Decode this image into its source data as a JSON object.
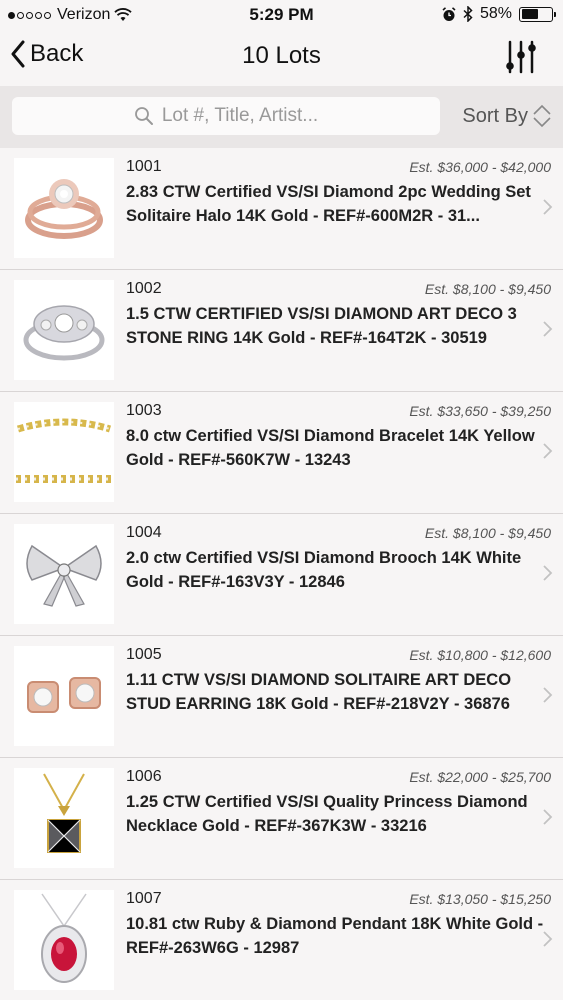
{
  "status_bar": {
    "carrier": "Verizon",
    "time": "5:29 PM",
    "battery_text": "58%",
    "battery_level": 0.58
  },
  "nav": {
    "back_label": "Back",
    "title": "10 Lots"
  },
  "search": {
    "placeholder": "Lot #, Title, Artist...",
    "sort_label": "Sort By"
  },
  "lots": [
    {
      "number": "1001",
      "estimate": "Est. $36,000 - $42,000",
      "title": "2.83 CTW Certified VS/SI Diamond 2pc Wedding Set Solitaire Halo 14K Gold - REF#-600M2R - 31...",
      "image": "rose-gold-halo-ring-set"
    },
    {
      "number": "1002",
      "estimate": "Est. $8,100 - $9,450",
      "title": "1.5 CTW CERTIFIED VS/SI DIAMOND ART DECO 3 STONE RING 14K Gold - REF#-164T2K - 30519",
      "image": "white-gold-art-deco-ring"
    },
    {
      "number": "1003",
      "estimate": "Est. $33,650 - $39,250",
      "title": "8.0 ctw Certified VS/SI Diamond Bracelet 14K Yellow Gold - REF#-560K7W - 13243",
      "image": "yellow-gold-diamond-bracelet"
    },
    {
      "number": "1004",
      "estimate": "Est. $8,100 - $9,450",
      "title": "2.0 ctw Certified VS/SI Diamond Brooch 14K White Gold - REF#-163V3Y - 12846",
      "image": "white-gold-bow-brooch"
    },
    {
      "number": "1005",
      "estimate": "Est. $10,800 - $12,600",
      "title": "1.11 CTW VS/SI DIAMOND SOLITAIRE ART DECO STUD EARRING 18K Gold - REF#-218V2Y - 36876",
      "image": "rose-gold-stud-earrings"
    },
    {
      "number": "1006",
      "estimate": "Est. $22,000 - $25,700",
      "title": "1.25 CTW Certified VS/SI Quality Princess Diamond Necklace Gold - REF#-367K3W - 33216",
      "image": "princess-diamond-necklace"
    },
    {
      "number": "1007",
      "estimate": "Est. $13,050 - $15,250",
      "title": "10.81 ctw Ruby & Diamond Pendant 18K White Gold - REF#-263W6G - 12987",
      "image": "ruby-diamond-pendant"
    }
  ]
}
